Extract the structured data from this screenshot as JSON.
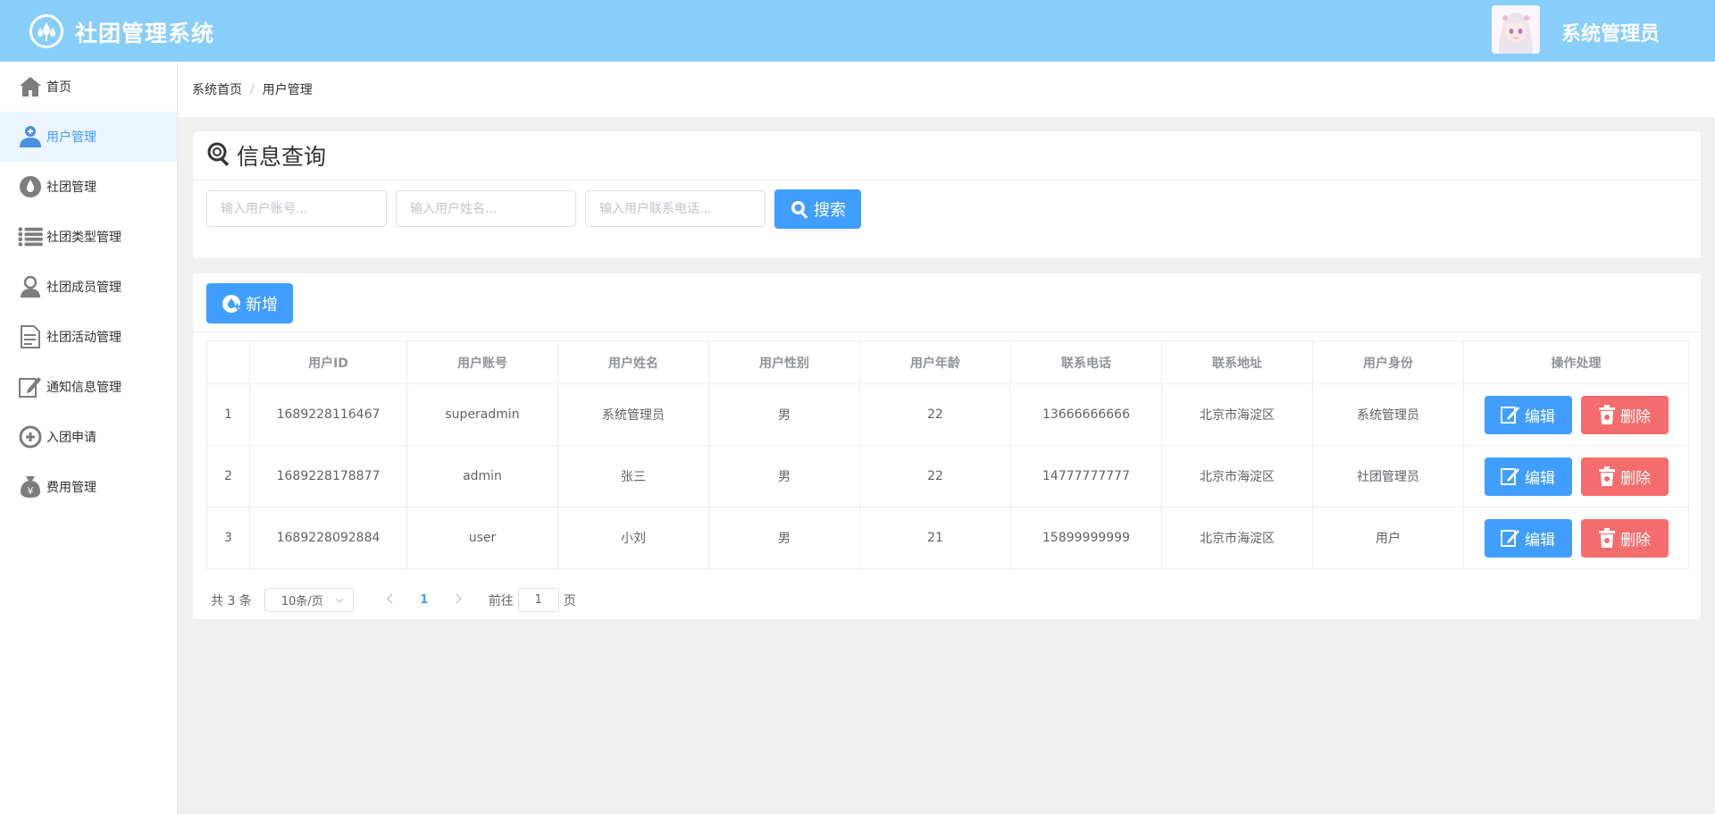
{
  "header": {
    "app_title": "社团管理系统",
    "user_name": "系统管理员"
  },
  "sidebar": {
    "items": [
      {
        "label": "首页",
        "icon": "home-icon"
      },
      {
        "label": "用户管理",
        "icon": "user-plus-icon",
        "active": true
      },
      {
        "label": "社团管理",
        "icon": "drop-icon"
      },
      {
        "label": "社团类型管理",
        "icon": "list-icon"
      },
      {
        "label": "社团成员管理",
        "icon": "member-icon"
      },
      {
        "label": "社团活动管理",
        "icon": "document-icon"
      },
      {
        "label": "通知信息管理",
        "icon": "edit-note-icon"
      },
      {
        "label": "入团申请",
        "icon": "apply-icon"
      },
      {
        "label": "费用管理",
        "icon": "money-icon"
      }
    ]
  },
  "breadcrumb": {
    "home": "系统首页",
    "separator": "/",
    "current": "用户管理"
  },
  "search": {
    "title": "信息查询",
    "account_placeholder": "输入用户账号...",
    "name_placeholder": "输入用户姓名...",
    "phone_placeholder": "输入用户联系电话...",
    "button_label": "搜索"
  },
  "toolbar": {
    "add_label": "新增"
  },
  "table": {
    "columns": [
      "",
      "用户ID",
      "用户账号",
      "用户姓名",
      "用户性别",
      "用户年龄",
      "联系电话",
      "联系地址",
      "用户身份",
      "操作处理"
    ],
    "rows": [
      [
        "1",
        "1689228116467",
        "superadmin",
        "系统管理员",
        "男",
        "22",
        "13666666666",
        "北京市海淀区",
        "系统管理员"
      ],
      [
        "2",
        "1689228178877",
        "admin",
        "张三",
        "男",
        "22",
        "14777777777",
        "北京市海淀区",
        "社团管理员"
      ],
      [
        "3",
        "1689228092884",
        "user",
        "小刘",
        "男",
        "21",
        "15899999999",
        "北京市海淀区",
        "用户"
      ]
    ],
    "edit_label": "编辑",
    "delete_label": "删除"
  },
  "pagination": {
    "total_text": "共 3 条",
    "page_size": "10条/页",
    "current_page": "1",
    "goto_prefix": "前往",
    "goto_value": "1",
    "goto_suffix": "页"
  },
  "colors": {
    "header": "#87cefa",
    "primary": "#409eff",
    "danger": "#f56c6c"
  }
}
